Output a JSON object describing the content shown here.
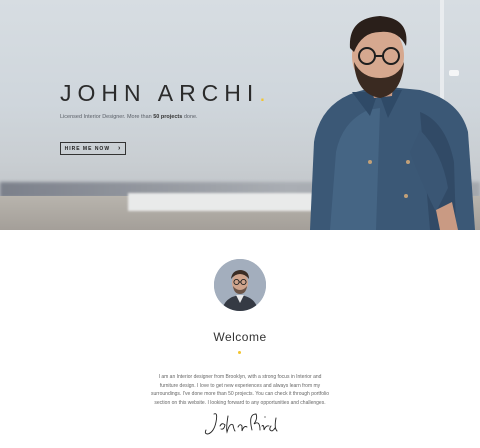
{
  "hero": {
    "name": "JOHN ARCHI",
    "name_dot": ".",
    "tagline_prefix": "Licensed Interior Designer. More than ",
    "tagline_bold": "50 projects",
    "tagline_suffix": " done.",
    "cta_label": "HIRE ME NOW",
    "cta_icon": "chevron-right-icon"
  },
  "about": {
    "heading": "Welcome",
    "bio_lines": [
      "I am an Interior designer from Brooklyn, with a strong focus in Interior and",
      "furniture design. I love to get new experiences and always learn from my",
      "surroundings. I've done more than 50 projects. You can check it through portfolio",
      "section on this website. I looking forward to any opportunities and challenges."
    ],
    "signature": "JohnArchi"
  },
  "colors": {
    "accent": "#f3c52e",
    "text_dark": "#2b2b2b",
    "text_muted": "#666666"
  }
}
